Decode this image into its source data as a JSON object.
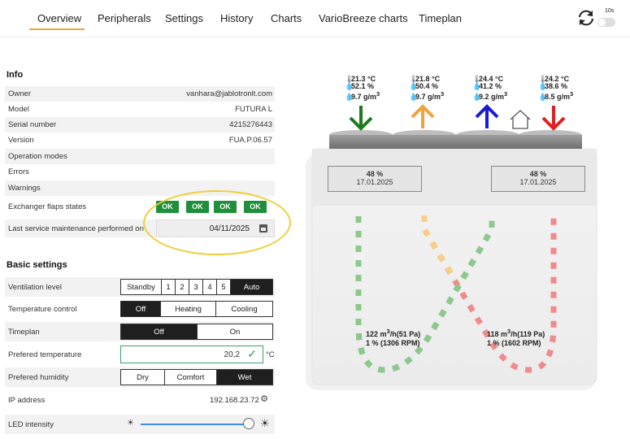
{
  "nav": {
    "tabs": [
      "Overview",
      "Peripherals",
      "Settings",
      "History",
      "Charts",
      "VarioBreeze charts",
      "Timeplan"
    ],
    "active_tab": "Overview",
    "toggle_label": "10s"
  },
  "info": {
    "title": "Info",
    "rows": [
      {
        "label": "Owner",
        "value": "vanhara@jablotronlt.com"
      },
      {
        "label": "Model",
        "value": "FUTURA L"
      },
      {
        "label": "Serial number",
        "value": "4215276443"
      },
      {
        "label": "Version",
        "value": "FUA.P.06.57"
      },
      {
        "label": "Operation modes",
        "value": ""
      },
      {
        "label": "Errors",
        "value": ""
      },
      {
        "label": "Warnings",
        "value": ""
      }
    ],
    "exchanger_label": "Exchanger flaps states",
    "exchanger_states": [
      "OK",
      "OK",
      "OK",
      "OK"
    ],
    "service_label": "Last service maintenance performed on",
    "service_date": "04/11/2025"
  },
  "basic": {
    "title": "Basic settings",
    "ventilation_label": "Ventilation level",
    "ventilation_options": [
      "Standby",
      "1",
      "2",
      "3",
      "4",
      "5",
      "Auto"
    ],
    "ventilation_selected": "Auto",
    "temp_control_label": "Temperature control",
    "temp_control_options": [
      "Off",
      "Heating",
      "Cooling"
    ],
    "temp_control_selected": "Off",
    "timeplan_label": "Timeplan",
    "timeplan_options": [
      "Off",
      "On"
    ],
    "timeplan_selected": "Off",
    "pref_temp_label": "Prefered temperature",
    "pref_temp_value": "20,2",
    "pref_temp_unit": "°C",
    "pref_hum_label": "Prefered humidity",
    "pref_hum_options": [
      "Dry",
      "Comfort",
      "Wet"
    ],
    "pref_hum_selected": "Wet",
    "ip_label": "IP address",
    "ip_value": "192.168.23.72",
    "led_label": "LED intensity",
    "led_level": 0.95
  },
  "device": {
    "sensors": [
      {
        "temp": "21.3 °C",
        "hum": "52.1 %",
        "abs": "9.7 g/m",
        "arrow": "down",
        "color": "#1d7a1d"
      },
      {
        "temp": "21.8 °C",
        "hum": "50.4 %",
        "abs": "9.7 g/m",
        "arrow": "up",
        "color": "#f2a23a"
      },
      {
        "temp": "24.4 °C",
        "hum": "41.2 %",
        "abs": "9.2 g/m",
        "arrow": "up",
        "color": "#1a1ad6"
      },
      {
        "temp": "24.2 °C",
        "hum": "38.6 %",
        "abs": "8.5 g/m",
        "arrow": "down",
        "color": "#e02020"
      }
    ],
    "displays": [
      {
        "pct": "48 %",
        "date": "17.01.2025"
      },
      {
        "pct": "48 %",
        "date": "17.01.2025"
      }
    ],
    "flows": [
      {
        "line1": "122 m",
        "line1b": "/h(51 Pa)",
        "line2": "1 % (1306 RPM)"
      },
      {
        "line1": "118 m",
        "line1b": "/h(119 Pa)",
        "line2": "1 % (1602 RPM)"
      }
    ],
    "path_colors": [
      "#8cc98a",
      "#f8cf86",
      "#7f7ff0",
      "#f08b8b"
    ]
  }
}
